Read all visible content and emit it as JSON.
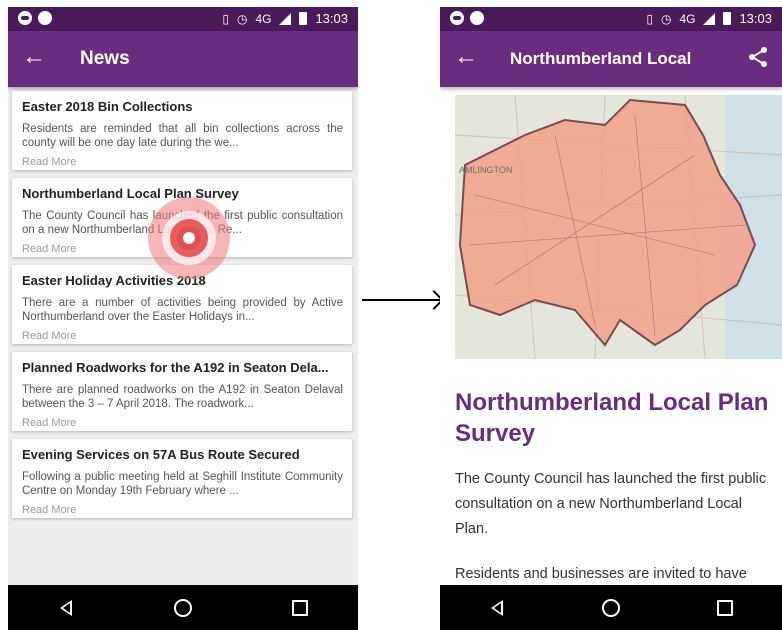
{
  "statusbar": {
    "network": "4G",
    "time": "13:03"
  },
  "left": {
    "title": "News",
    "articles": [
      {
        "title": "Easter 2018 Bin Collections",
        "body": "Residents are reminded that all bin collections across the county will be one day late during the we...",
        "more": "Read More"
      },
      {
        "title": "Northumberland Local Plan Survey",
        "body": "The County Council has launched the first public consultation on a new Northumberland Local Plan. Re...",
        "more": "Read More"
      },
      {
        "title": "Easter Holiday Activities 2018",
        "body": "There are a number of activities being provided by Active Northumberland over the Easter Holidays in...",
        "more": "Read More"
      },
      {
        "title": "Planned Roadworks for the A192 in Seaton Dela...",
        "body": "There are planned roadworks on the A192 in Seaton Delaval between the 3 – 7 April 2018. The roadwork...",
        "more": "Read More"
      },
      {
        "title": "Evening Services on 57A Bus Route Secured",
        "body": "Following a public meeting held at Seghill Institute Community Centre on Monday 19th February where ...",
        "more": "Read More"
      }
    ]
  },
  "right": {
    "title": "Northumberland Local",
    "map_label": "AMLINGTON",
    "heading": "Northumberland Local Plan Survey",
    "paragraphs": [
      "The County Council has launched the first public consultation on a new Northumberland Local Plan.",
      "Residents and businesses are invited to have"
    ]
  },
  "colors": {
    "statusbar": "#4a1a5a",
    "appbar": "#6a2c7e",
    "accent": "#6a2c7e",
    "tap": "#e25050"
  },
  "icons": {
    "back": "arrow-left-icon",
    "share": "share-icon",
    "nav_back": "triangle-back-icon",
    "nav_home": "circle-home-icon",
    "nav_recent": "square-recent-icon"
  }
}
